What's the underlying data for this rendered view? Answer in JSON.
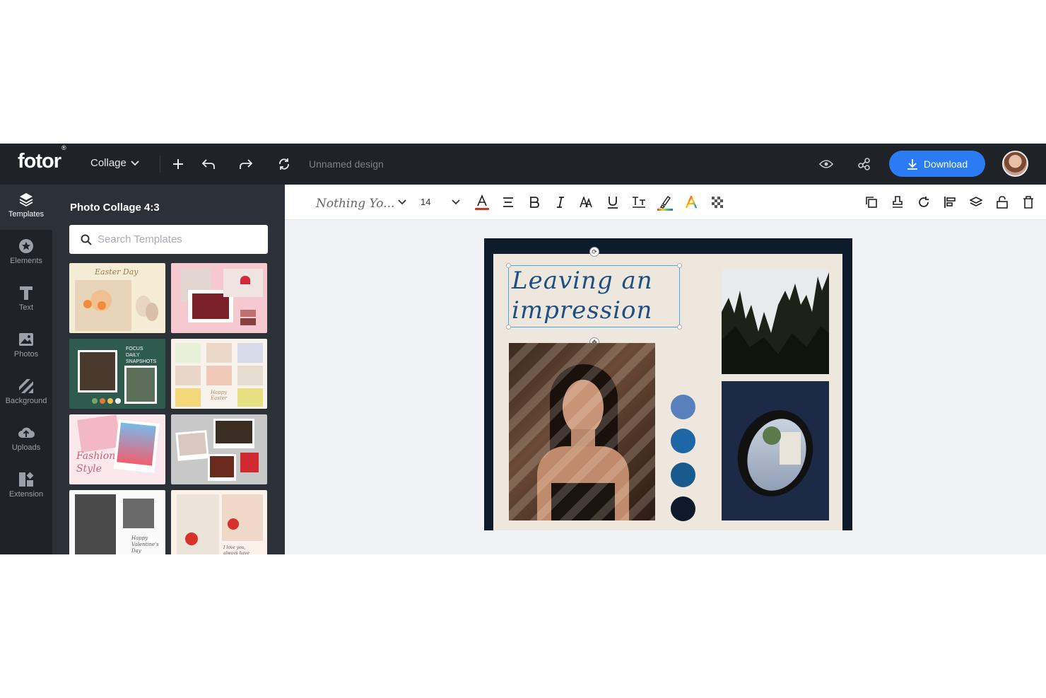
{
  "app": {
    "logo": "fotor",
    "logo_mark": "®",
    "mode": "Collage",
    "design_name": "Unnamed design",
    "download_label": "Download",
    "accent": "#2b7bf5"
  },
  "rail": {
    "items": [
      {
        "label": "Templates",
        "icon": "templates-icon"
      },
      {
        "label": "Elements",
        "icon": "elements-icon"
      },
      {
        "label": "Text",
        "icon": "text-icon"
      },
      {
        "label": "Photos",
        "icon": "photos-icon"
      },
      {
        "label": "Background",
        "icon": "background-icon"
      },
      {
        "label": "Uploads",
        "icon": "uploads-icon"
      },
      {
        "label": "Extension",
        "icon": "extension-icon"
      }
    ]
  },
  "panel": {
    "title": "Photo Collage 4:3",
    "search_placeholder": "Search Templates",
    "templates": [
      {
        "caption": "Easter Day"
      },
      {
        "caption": ""
      },
      {
        "caption": "FOCUS DAILY SNAPSHOTS"
      },
      {
        "caption": "Happy Easter"
      },
      {
        "caption": "Fashion Style"
      },
      {
        "caption": ""
      },
      {
        "caption": "Happy Valentine's Day"
      },
      {
        "caption": "I love you, always have"
      }
    ]
  },
  "toolbar": {
    "font_name": "Nothing Yo...",
    "font_size": "14",
    "text_color": "#c0392b"
  },
  "canvas": {
    "heading_line1": "Leaving an",
    "heading_line2": "impression",
    "swatches": [
      "#5a7fbd",
      "#1f66a6",
      "#185a8e",
      "#0c1a2c"
    ]
  }
}
